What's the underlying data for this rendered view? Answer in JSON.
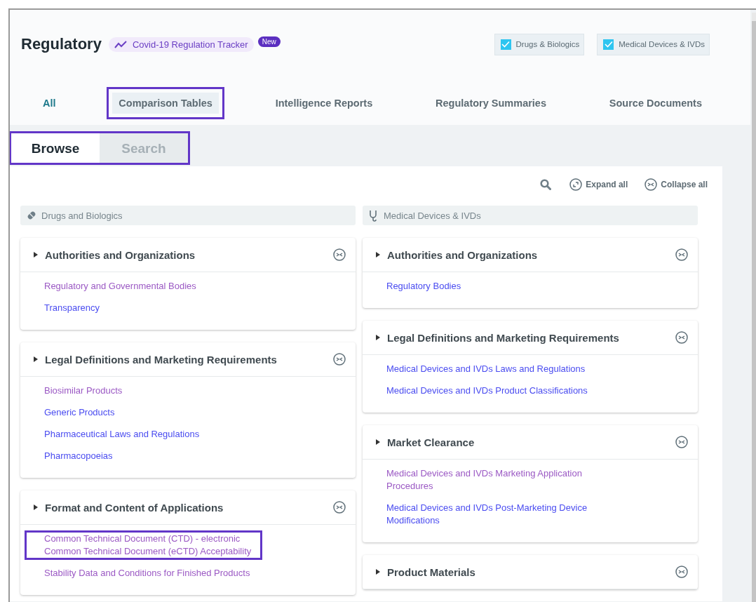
{
  "header": {
    "title": "Regulatory",
    "tracker": {
      "label": "Covid-19 Regulation Tracker"
    },
    "badge": "New",
    "filters": [
      {
        "label": "Drugs & Biologics",
        "checked": true
      },
      {
        "label": "Medical Devices & IVDs",
        "checked": true
      }
    ]
  },
  "tabs": [
    {
      "label": "All",
      "selected": true,
      "hovered": false,
      "highlighted": false
    },
    {
      "label": "Comparison Tables",
      "selected": false,
      "hovered": true,
      "highlighted": true
    },
    {
      "label": "Intelligence Reports",
      "selected": false,
      "hovered": false,
      "highlighted": false
    },
    {
      "label": "Regulatory Summaries",
      "selected": false,
      "hovered": false,
      "highlighted": false
    },
    {
      "label": "Source Documents",
      "selected": false,
      "hovered": false,
      "highlighted": false
    }
  ],
  "view_tabs": {
    "highlighted": true,
    "items": [
      {
        "label": "Browse",
        "selected": true
      },
      {
        "label": "Search",
        "selected": false
      }
    ]
  },
  "toolbar": {
    "expand_label": "Expand all",
    "collapse_label": "Collapse all"
  },
  "columns": [
    {
      "title": "Drugs and Biologics",
      "kind": "drugs",
      "sections": [
        {
          "title": "Authorities and Organizations",
          "links": [
            {
              "label": "Regulatory and Governmental Bodies",
              "visited": true,
              "highlighted": false
            },
            {
              "label": "Transparency",
              "visited": false,
              "highlighted": false
            }
          ]
        },
        {
          "title": "Legal Definitions and Marketing Requirements",
          "links": [
            {
              "label": "Biosimilar Products",
              "visited": true,
              "highlighted": false
            },
            {
              "label": "Generic Products",
              "visited": false,
              "highlighted": false
            },
            {
              "label": "Pharmaceutical Laws and Regulations",
              "visited": false,
              "highlighted": false
            },
            {
              "label": "Pharmacopoeias",
              "visited": false,
              "highlighted": false
            }
          ]
        },
        {
          "title": "Format and Content of Applications",
          "links": [
            {
              "label": "Common Technical Document (CTD) - electronic Common Technical Document (eCTD) Acceptability",
              "visited": true,
              "highlighted": true
            },
            {
              "label": "Stability Data and Conditions for Finished Products",
              "visited": true,
              "highlighted": false
            }
          ]
        }
      ]
    },
    {
      "title": "Medical Devices & IVDs",
      "kind": "devices",
      "sections": [
        {
          "title": "Authorities and Organizations",
          "links": [
            {
              "label": "Regulatory Bodies",
              "visited": false,
              "highlighted": false
            }
          ]
        },
        {
          "title": "Legal Definitions and Marketing Requirements",
          "links": [
            {
              "label": "Medical Devices and IVDs Laws and Regulations",
              "visited": false,
              "highlighted": false
            },
            {
              "label": "Medical Devices and IVDs Product Classifications",
              "visited": false,
              "highlighted": false
            }
          ]
        },
        {
          "title": "Market Clearance",
          "links": [
            {
              "label": "Medical Devices and IVDs Marketing Application Procedures",
              "visited": true,
              "highlighted": false
            },
            {
              "label": "Medical Devices and IVDs Post-Marketing Device Modifications",
              "visited": false,
              "highlighted": false
            }
          ]
        },
        {
          "title": "Product Materials"
        }
      ]
    }
  ]
}
